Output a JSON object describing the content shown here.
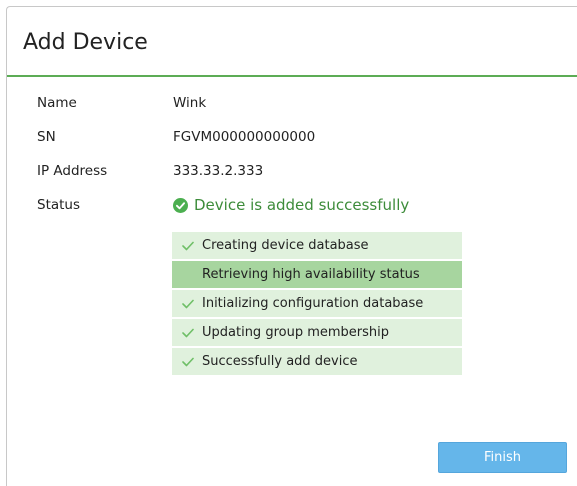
{
  "dialog": {
    "title": "Add Device"
  },
  "fields": {
    "name_label": "Name",
    "name_value": "Wink",
    "sn_label": "SN",
    "sn_value": "FGVM000000000000",
    "ip_label": "IP Address",
    "ip_value": "333.33.2.333",
    "status_label": "Status",
    "status_value": "Device is added successfully"
  },
  "steps": [
    {
      "label": "Creating device database",
      "done": true
    },
    {
      "label": "Retrieving high availability status",
      "done": false,
      "active": true
    },
    {
      "label": "Initializing configuration database",
      "done": true
    },
    {
      "label": "Updating group membership",
      "done": true
    },
    {
      "label": "Successfully add device",
      "done": true
    }
  ],
  "buttons": {
    "finish_label": "Finish"
  },
  "colors": {
    "accent_green": "#5cac55",
    "status_green": "#3d8c3a",
    "step_bg": "#e0f1dd",
    "step_active_bg": "#a7d59f",
    "finish_button": "#65b6ea"
  },
  "icons": {
    "status": "check-circle-icon",
    "step": "checkmark-icon"
  }
}
